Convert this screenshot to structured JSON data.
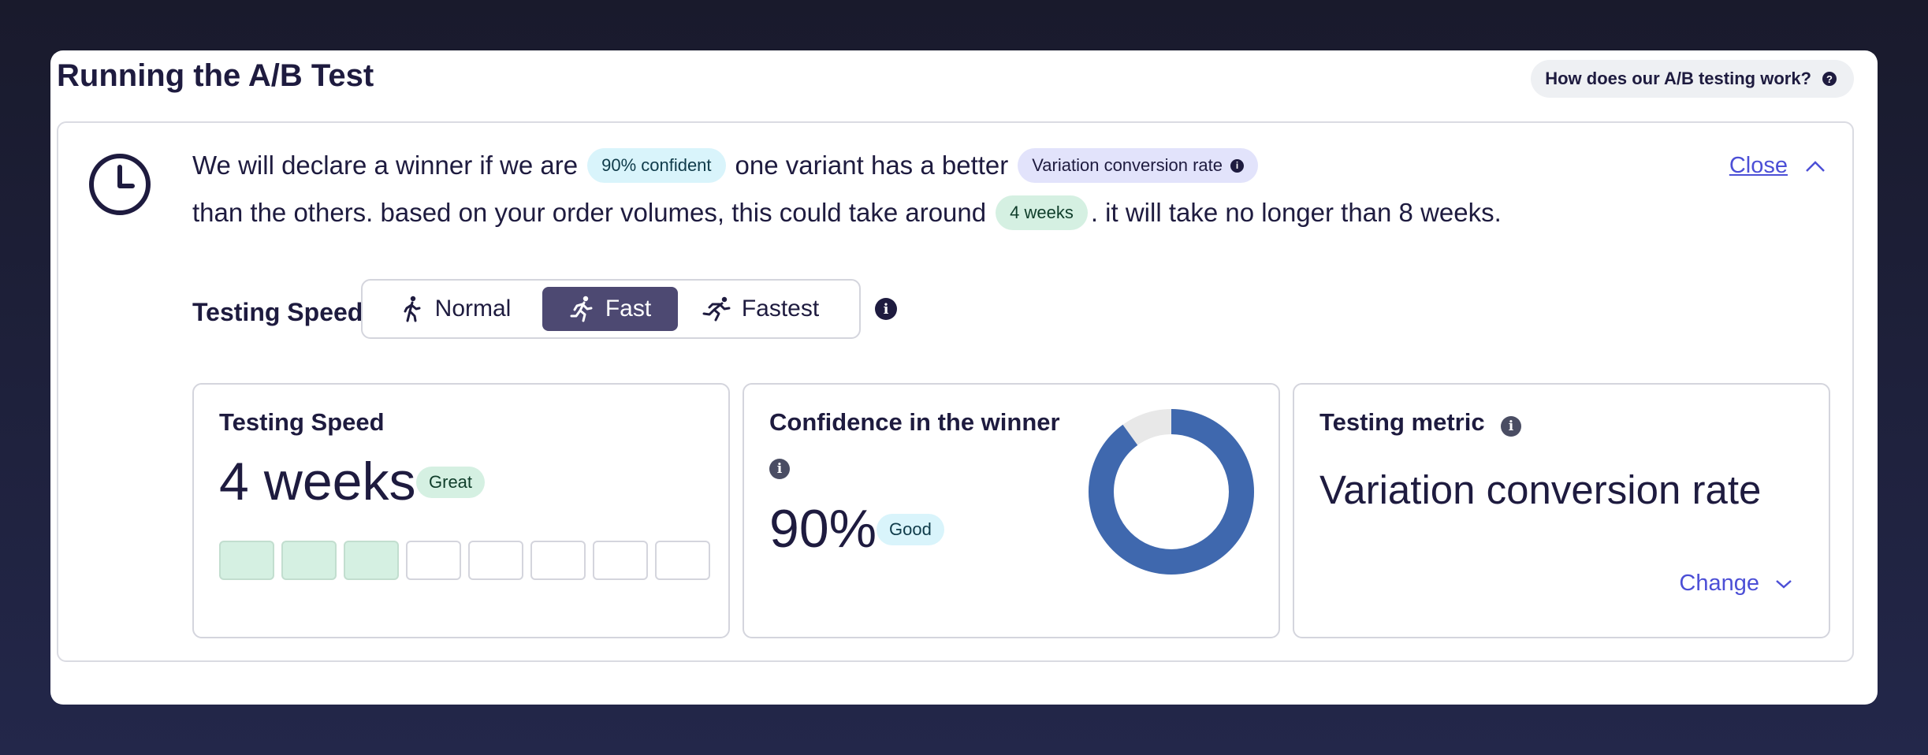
{
  "page": {
    "title": "Running the A/B Test",
    "help_label": "How does our A/B testing work?",
    "help_icon": "?"
  },
  "summary": {
    "line1_pre": "We will declare a winner if we are",
    "confidence_pill": "90% confident",
    "line1_mid": "one variant has a better",
    "metric_pill": "Variation conversion rate",
    "line2_pre": "than the others. based on your order volumes, this could take around",
    "duration_pill": "4 weeks",
    "line2_post": ". it will take no longer than 8 weeks.",
    "close_label": "Close"
  },
  "speed_selector": {
    "label": "Testing Speed",
    "options": [
      "Normal",
      "Fast",
      "Fastest"
    ],
    "selected": "Fast"
  },
  "cards": {
    "speed": {
      "title": "Testing Speed",
      "value": "4 weeks",
      "badge": "Great",
      "filled_segments": 3,
      "total_segments": 8
    },
    "confidence": {
      "title": "Confidence in the winner",
      "value": "90%",
      "badge": "Good",
      "fraction": 0.9
    },
    "metric": {
      "title": "Testing metric",
      "value": "Variation conversion rate",
      "change_label": "Change"
    }
  },
  "colors": {
    "accent": "#4c4fd6",
    "donut": "#3f68ae",
    "donut_track": "#e8e8e8",
    "selected_option": "#4d4972"
  }
}
